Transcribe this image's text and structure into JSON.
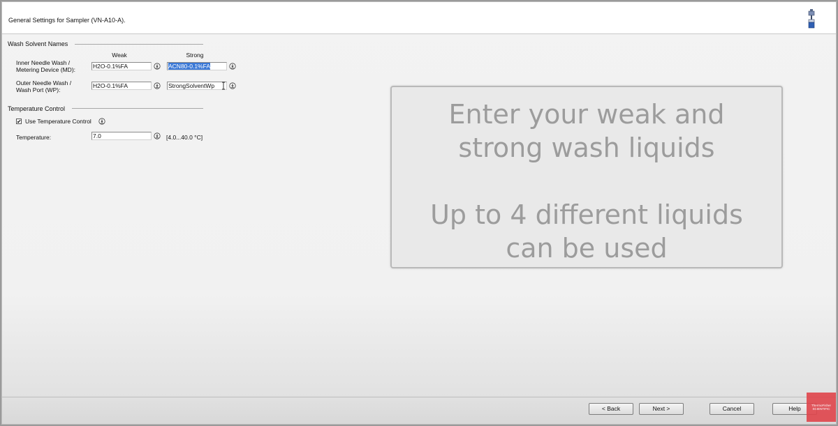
{
  "header": {
    "title": "General Settings for Sampler (VN-A10-A)."
  },
  "wash_solvent_names": {
    "group_title": "Wash Solvent Names",
    "col_weak": "Weak",
    "col_strong": "Strong",
    "rows": [
      {
        "label_line1": "Inner Needle Wash /",
        "label_line2": "Metering Device (MD):",
        "weak_value": "H2O-0.1%FA",
        "strong_value": "ACN80-0.1%FA"
      },
      {
        "label_line1": "Outer Needle Wash /",
        "label_line2": "Wash Port (WP):",
        "weak_value": "H2O-0.1%FA",
        "strong_value": "StrongSolventWp"
      }
    ]
  },
  "temperature_control": {
    "group_title": "Temperature Control",
    "checkbox_label": "Use Temperature Control",
    "checkbox_checked": true,
    "checkbox_mark": "✔",
    "temperature_label": "Temperature:",
    "temperature_value": "7.0",
    "temperature_range": "[4.0...40.0 °C]"
  },
  "overlay": {
    "line1": "Enter your weak and",
    "line2": "strong wash liquids",
    "line3": "Up to 4 different liquids",
    "line4": "can be used"
  },
  "footer": {
    "back_label": "< Back",
    "next_label": "Next >",
    "cancel_label": "Cancel",
    "help_label": "Help"
  },
  "logo": {
    "text": "ThermoFisher SCIENTIFIC"
  },
  "colors": {
    "selection": "#3a78d6",
    "overlay_text": "#9c9c9c",
    "logo": "#e0454c"
  }
}
